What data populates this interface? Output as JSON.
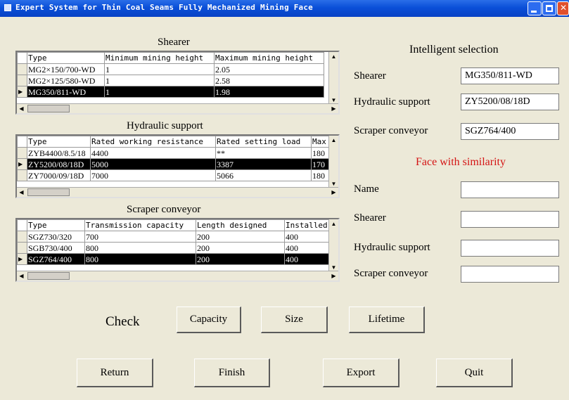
{
  "window": {
    "title": "Expert System for Thin Coal Seams Fully Mechanized Mining Face"
  },
  "shearer": {
    "title": "Shearer",
    "columns": [
      "Type",
      "Minimum mining height",
      "Maximum mining height"
    ],
    "rows": [
      [
        "MG2×150/700-WD",
        "1",
        "2.05"
      ],
      [
        "MG2×125/580-WD",
        "1",
        "2.58"
      ],
      [
        "MG350/811-WD",
        "1",
        "1.98"
      ]
    ],
    "selected_row": 2
  },
  "hydraulic": {
    "title": "Hydraulic support",
    "columns": [
      "Type",
      "Rated working resistance",
      "Rated setting load",
      "Max"
    ],
    "rows": [
      [
        "ZYB4400/8.5/18",
        "4400",
        "**",
        "180"
      ],
      [
        "ZY5200/08/18D",
        "5000",
        "3387",
        "170"
      ],
      [
        "ZY7000/09/18D",
        "7000",
        "5066",
        "180"
      ]
    ],
    "selected_row": 1
  },
  "conveyor": {
    "title": "Scraper conveyor",
    "columns": [
      "Type",
      "Transmission capacity",
      "Length designed",
      "Installed"
    ],
    "rows": [
      [
        "SGZ730/320",
        "700",
        "200",
        "400"
      ],
      [
        "SGB730/400",
        "800",
        "200",
        "400"
      ],
      [
        "SGZ764/400",
        "800",
        "200",
        "400"
      ]
    ],
    "selected_row": 2
  },
  "intelligent": {
    "title": "Intelligent selection",
    "shearer_label": "Shearer",
    "shearer_value": "MG350/811-WD",
    "hydraulic_label": "Hydraulic support",
    "hydraulic_value": "ZY5200/08/18D",
    "conveyor_label": "Scraper conveyor",
    "conveyor_value": "SGZ764/400"
  },
  "similarity": {
    "title": "Face with similarity",
    "title_color": "#d41414",
    "name_label": "Name",
    "name_value": "",
    "shearer_label": "Shearer",
    "shearer_value": "",
    "hydraulic_label": "Hydraulic support",
    "hydraulic_value": "",
    "conveyor_label": "Scraper conveyor",
    "conveyor_value": ""
  },
  "check": {
    "label": "Check",
    "buttons": [
      "Capacity",
      "Size",
      "Lifetime"
    ]
  },
  "actions": [
    "Return",
    "Finish",
    "Export",
    "Quit"
  ]
}
